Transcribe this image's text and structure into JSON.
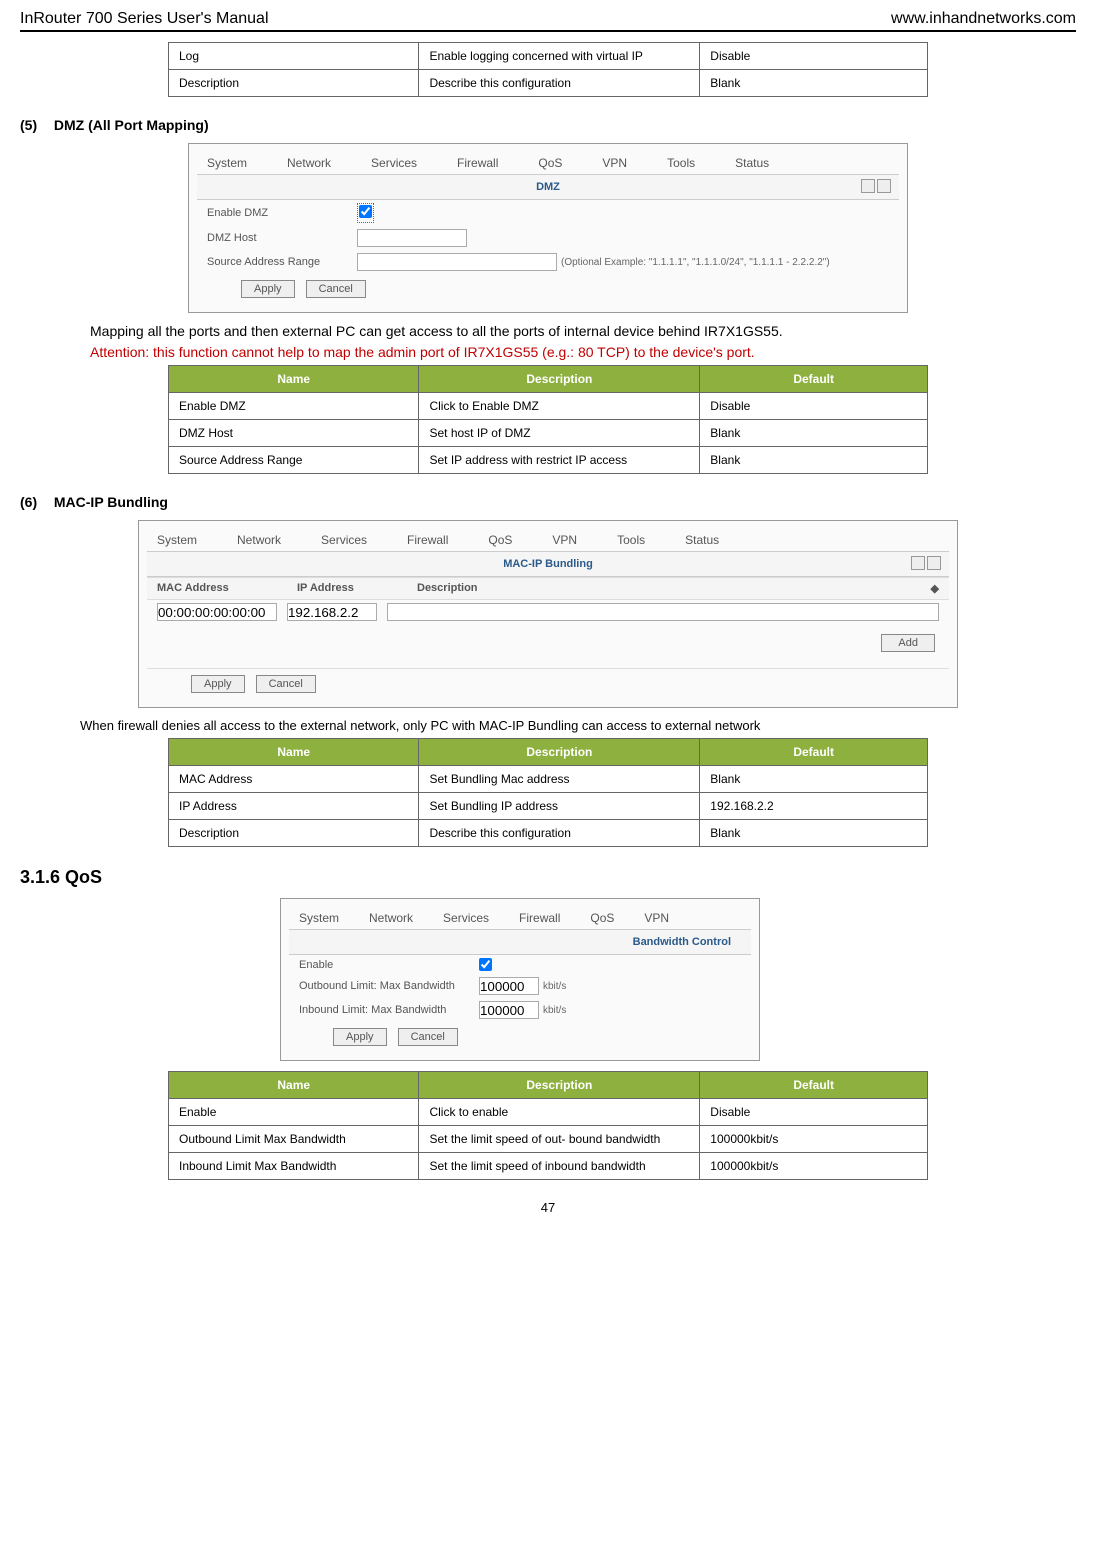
{
  "header": {
    "left": "InRouter 700 Series User's Manual",
    "right": "www.inhandnetworks.com"
  },
  "tableTop": {
    "rows": [
      {
        "name": "Log",
        "desc": "Enable logging concerned with virtual IP",
        "def": "Disable"
      },
      {
        "name": "Description",
        "desc": "Describe this configuration",
        "def": "Blank"
      }
    ]
  },
  "sec5": {
    "num": "(5)",
    "title": "DMZ (All Port Mapping)",
    "shot": {
      "nav": [
        "System",
        "Network",
        "Services",
        "Firewall",
        "QoS",
        "VPN",
        "Tools",
        "Status"
      ],
      "panelTitle": "DMZ",
      "enableLabel": "Enable DMZ",
      "hostLabel": "DMZ Host",
      "srcLabel": "Source Address Range",
      "srcHint": "(Optional Example: \"1.1.1.1\", \"1.1.1.0/24\", \"1.1.1.1 - 2.2.2.2\")",
      "apply": "Apply",
      "cancel": "Cancel"
    },
    "prose": "Mapping all the ports and then external PC can get access to all the ports of internal device behind IR7X1GS55.",
    "attention": "Attention: this function cannot help to map the admin port of IR7X1GS55 (e.g.: 80 TCP) to the device's port.",
    "thead": {
      "name": "Name",
      "desc": "Description",
      "def": "Default"
    },
    "rows": [
      {
        "name": "Enable DMZ",
        "desc": "Click to Enable DMZ",
        "def": "Disable"
      },
      {
        "name": "DMZ Host",
        "desc": "Set host IP of DMZ",
        "def": "Blank"
      },
      {
        "name": "Source Address Range",
        "desc": "Set IP address with restrict IP access",
        "def": "Blank"
      }
    ]
  },
  "sec6": {
    "num": "(6)",
    "title": "MAC-IP Bundling",
    "shot": {
      "nav": [
        "System",
        "Network",
        "Services",
        "Firewall",
        "QoS",
        "VPN",
        "Tools",
        "Status"
      ],
      "panelTitle": "MAC-IP Bundling",
      "colMac": "MAC Address",
      "colIp": "IP Address",
      "colDesc": "Description",
      "macDefault": "00:00:00:00:00:00",
      "ipDefault": "192.168.2.2",
      "addBtn": "Add",
      "apply": "Apply",
      "cancel": "Cancel"
    },
    "prose": "When firewall denies all access to the external network, only PC with MAC-IP Bundling can access to external network",
    "thead": {
      "name": "Name",
      "desc": "Description",
      "def": "Default"
    },
    "rows": [
      {
        "name": "MAC Address",
        "desc": "Set Bundling Mac address",
        "def": "Blank"
      },
      {
        "name": "IP Address",
        "desc": "Set Bundling IP address",
        "def": "192.168.2.2"
      },
      {
        "name": "Description",
        "desc": "Describe this configuration",
        "def": "Blank"
      }
    ]
  },
  "qos": {
    "heading": "3.1.6 QoS",
    "shot": {
      "nav": [
        "System",
        "Network",
        "Services",
        "Firewall",
        "QoS",
        "VPN"
      ],
      "panelTitle": "Bandwidth Control",
      "enableLabel": "Enable",
      "outLabel": "Outbound Limit: Max Bandwidth",
      "outVal": "100000",
      "unit": "kbit/s",
      "inLabel": "Inbound Limit: Max Bandwidth",
      "inVal": "100000",
      "apply": "Apply",
      "cancel": "Cancel"
    },
    "thead": {
      "name": "Name",
      "desc": "Description",
      "def": "Default"
    },
    "rows": [
      {
        "name": "Enable",
        "desc": "Click to enable",
        "def": "Disable"
      },
      {
        "name": "Outbound Limit Max Bandwidth",
        "desc": "Set the limit speed of out- bound bandwidth",
        "def": "100000kbit/s"
      },
      {
        "name": "Inbound Limit Max Bandwidth",
        "desc": "Set the limit speed of inbound bandwidth",
        "def": "100000kbit/s"
      }
    ]
  },
  "pagenum": "47"
}
